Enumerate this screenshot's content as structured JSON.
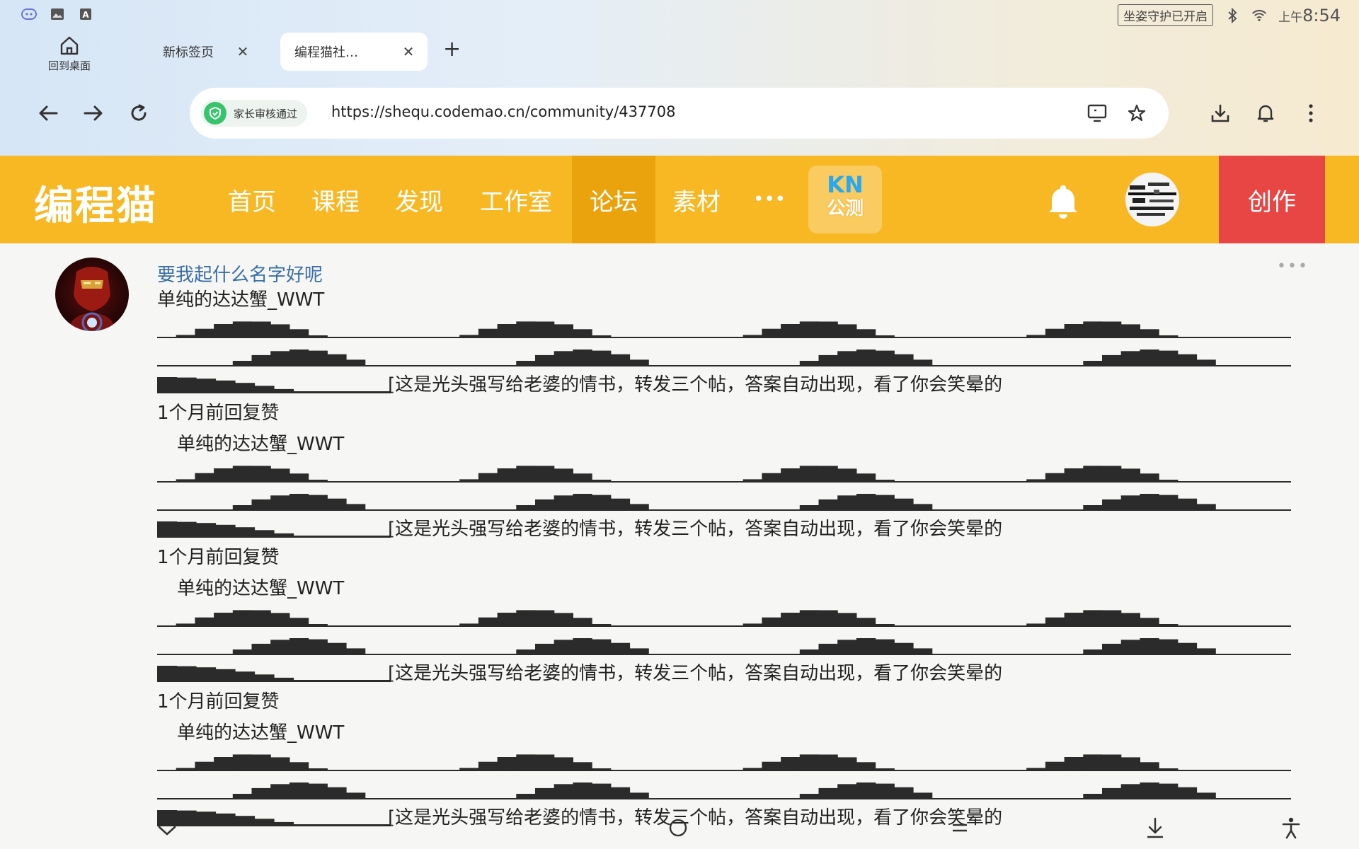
{
  "status_bar": {
    "guard_badge": "坐姿守护已开启",
    "clock_prefix": "上午",
    "clock_time": "8:54",
    "icons": [
      "assistant-icon",
      "gallery-icon",
      "keyboard-a-icon",
      "bluetooth-icon",
      "wifi-icon"
    ]
  },
  "tabs": {
    "home_label": "回到桌面",
    "items": [
      {
        "label": "新标签页",
        "active": false
      },
      {
        "label": "编程猫社…",
        "active": true
      }
    ]
  },
  "address_bar": {
    "verify_label": "家长审核通过",
    "url": "https://shequ.codemao.cn/community/437708"
  },
  "site_nav": {
    "logo": "编程猫",
    "items": [
      "首页",
      "课程",
      "发现",
      "工作室",
      "论坛",
      "素材",
      "•••"
    ],
    "active_item": "论坛",
    "kn_line1": "KN",
    "kn_line2": "公测",
    "create_label": "创作",
    "colors": {
      "nav_bg": "#f7b824",
      "active_bg": "#eaa20d",
      "create_bg": "#e84545",
      "kn_blue": "#27a8f0"
    }
  },
  "post": {
    "author": "要我起什么名字好呢",
    "replies": [
      {
        "name": "单纯的达达蟹_WWT",
        "text": "[这是光头强写给老婆的情书，转发三个帖，答案自动出现，看了你会笑晕的",
        "meta": "1个月前回复赞"
      },
      {
        "name": "单纯的达达蟹_WWT",
        "text": "[这是光头强写给老婆的情书，转发三个帖，答案自动出现，看了你会笑晕的",
        "meta": "1个月前回复赞"
      },
      {
        "name": "单纯的达达蟹_WWT",
        "text": "[这是光头强写给老婆的情书，转发三个帖，答案自动出现，看了你会笑晕的",
        "meta": "1个月前回复赞"
      },
      {
        "name": "单纯的达达蟹_WWT",
        "text": "[这是光头强写给老婆的情书，转发三个帖，答案自动出现，看了你会笑晕的",
        "meta": ""
      }
    ]
  }
}
